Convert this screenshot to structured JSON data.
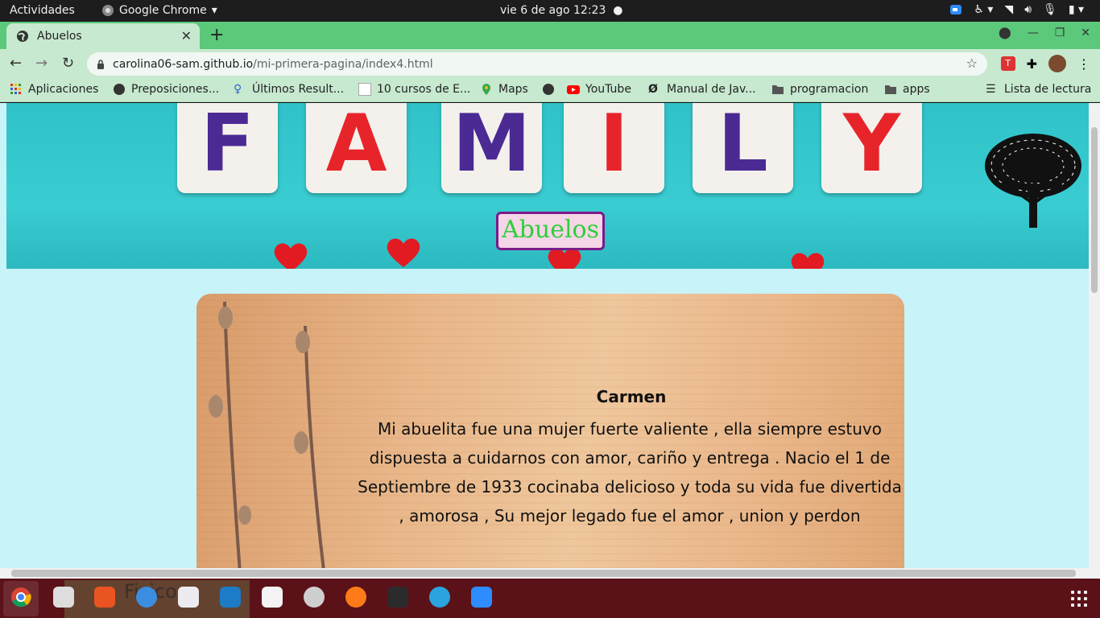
{
  "system_bar": {
    "activities": "Actividades",
    "app_name": "Google Chrome",
    "clock": "vie  6 de ago  12:23"
  },
  "browser": {
    "tab_title": "Abuelos",
    "url_host": "carolina06-sam.github.io",
    "url_path": "/mi-primera-pagina/index4.html",
    "bookmarks": [
      {
        "label": "Aplicaciones",
        "icon": "apps-grid-icon"
      },
      {
        "label": "Preposiciones...",
        "icon": "globe-icon"
      },
      {
        "label": "Últimos Result...",
        "icon": "search-person-icon"
      },
      {
        "label": "10 cursos de E...",
        "icon": "site-icon"
      },
      {
        "label": "Maps",
        "icon": "maps-pin-icon"
      },
      {
        "label": "",
        "icon": "globe-icon"
      },
      {
        "label": "YouTube",
        "icon": "youtube-icon"
      },
      {
        "label": "Manual de Jav...",
        "icon": "link-icon"
      },
      {
        "label": "programacion",
        "icon": "folder-icon"
      },
      {
        "label": "apps",
        "icon": "folder-icon"
      }
    ],
    "reading_list": "Lista de lectura"
  },
  "page": {
    "banner_letters": [
      "F",
      "A",
      "M",
      "I",
      "L",
      "Y"
    ],
    "banner_title": "Abuelos",
    "card": {
      "name": "Carmen",
      "text": "Mi abuelita fue una mujer fuerte valiente , ella siempre estuvo dispuesta a cuidarnos con amor, cariño y entrega . Nacio el 1 de Septiembre de 1933 cocinaba delicioso y toda su vida fue divertida , amorosa , Su mejor legado fue el amor , union y perdon"
    }
  },
  "dock": {
    "ghost_text": "Fisico",
    "apps": [
      "chrome-icon",
      "files-icon",
      "software-icon",
      "help-icon",
      "settings-toggle-icon",
      "vscode-icon",
      "text-editor-icon",
      "system-settings-icon",
      "firefox-icon",
      "terminal-icon",
      "telegram-icon",
      "zoom-icon"
    ]
  },
  "colors": {
    "tab_strip": "#5bc87a",
    "toolbar": "#c7e9cf",
    "page_bg": "#c8f3f8",
    "title_text": "#2ecf3a",
    "title_border": "#7b1a8a"
  }
}
